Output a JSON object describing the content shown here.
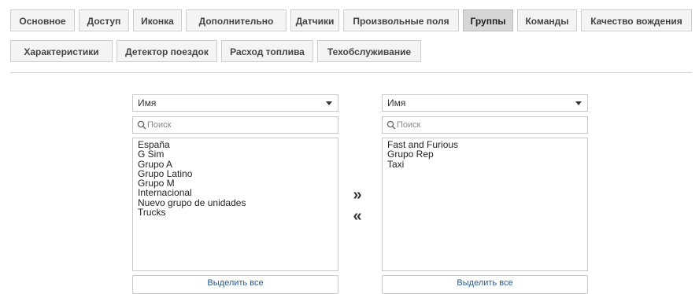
{
  "tabs": [
    {
      "label": "Основное",
      "active": false
    },
    {
      "label": "Доступ",
      "active": false
    },
    {
      "label": "Иконка",
      "active": false
    },
    {
      "label": "Дополнительно",
      "active": false
    },
    {
      "label": "Датчики",
      "active": false
    },
    {
      "label": "Произвольные поля",
      "active": false
    },
    {
      "label": "Группы",
      "active": true
    },
    {
      "label": "Команды",
      "active": false
    },
    {
      "label": "Качество вождения",
      "active": false
    },
    {
      "label": "Характеристики",
      "active": false
    },
    {
      "label": "Детектор поездок",
      "active": false
    },
    {
      "label": "Расход топлива",
      "active": false
    },
    {
      "label": "Техобслуживание",
      "active": false
    }
  ],
  "left_panel": {
    "sort_value": "Имя",
    "search_placeholder": "Поиск",
    "items": [
      "España",
      "G Sim",
      "Grupo A",
      "Grupo Latino",
      "Grupo M",
      "Internacional",
      "Nuevo grupo de unidades",
      "Trucks"
    ],
    "select_all_label": "Выделить все"
  },
  "right_panel": {
    "sort_value": "Имя",
    "search_placeholder": "Поиск",
    "items": [
      "Fast and Furious",
      "Grupo Rep",
      "Taxi"
    ],
    "select_all_label": "Выделить все"
  },
  "transfer": {
    "move_right": "»",
    "move_left": "«"
  },
  "icons": {
    "search": "search-icon",
    "dropdown": "chevron-down-icon"
  }
}
